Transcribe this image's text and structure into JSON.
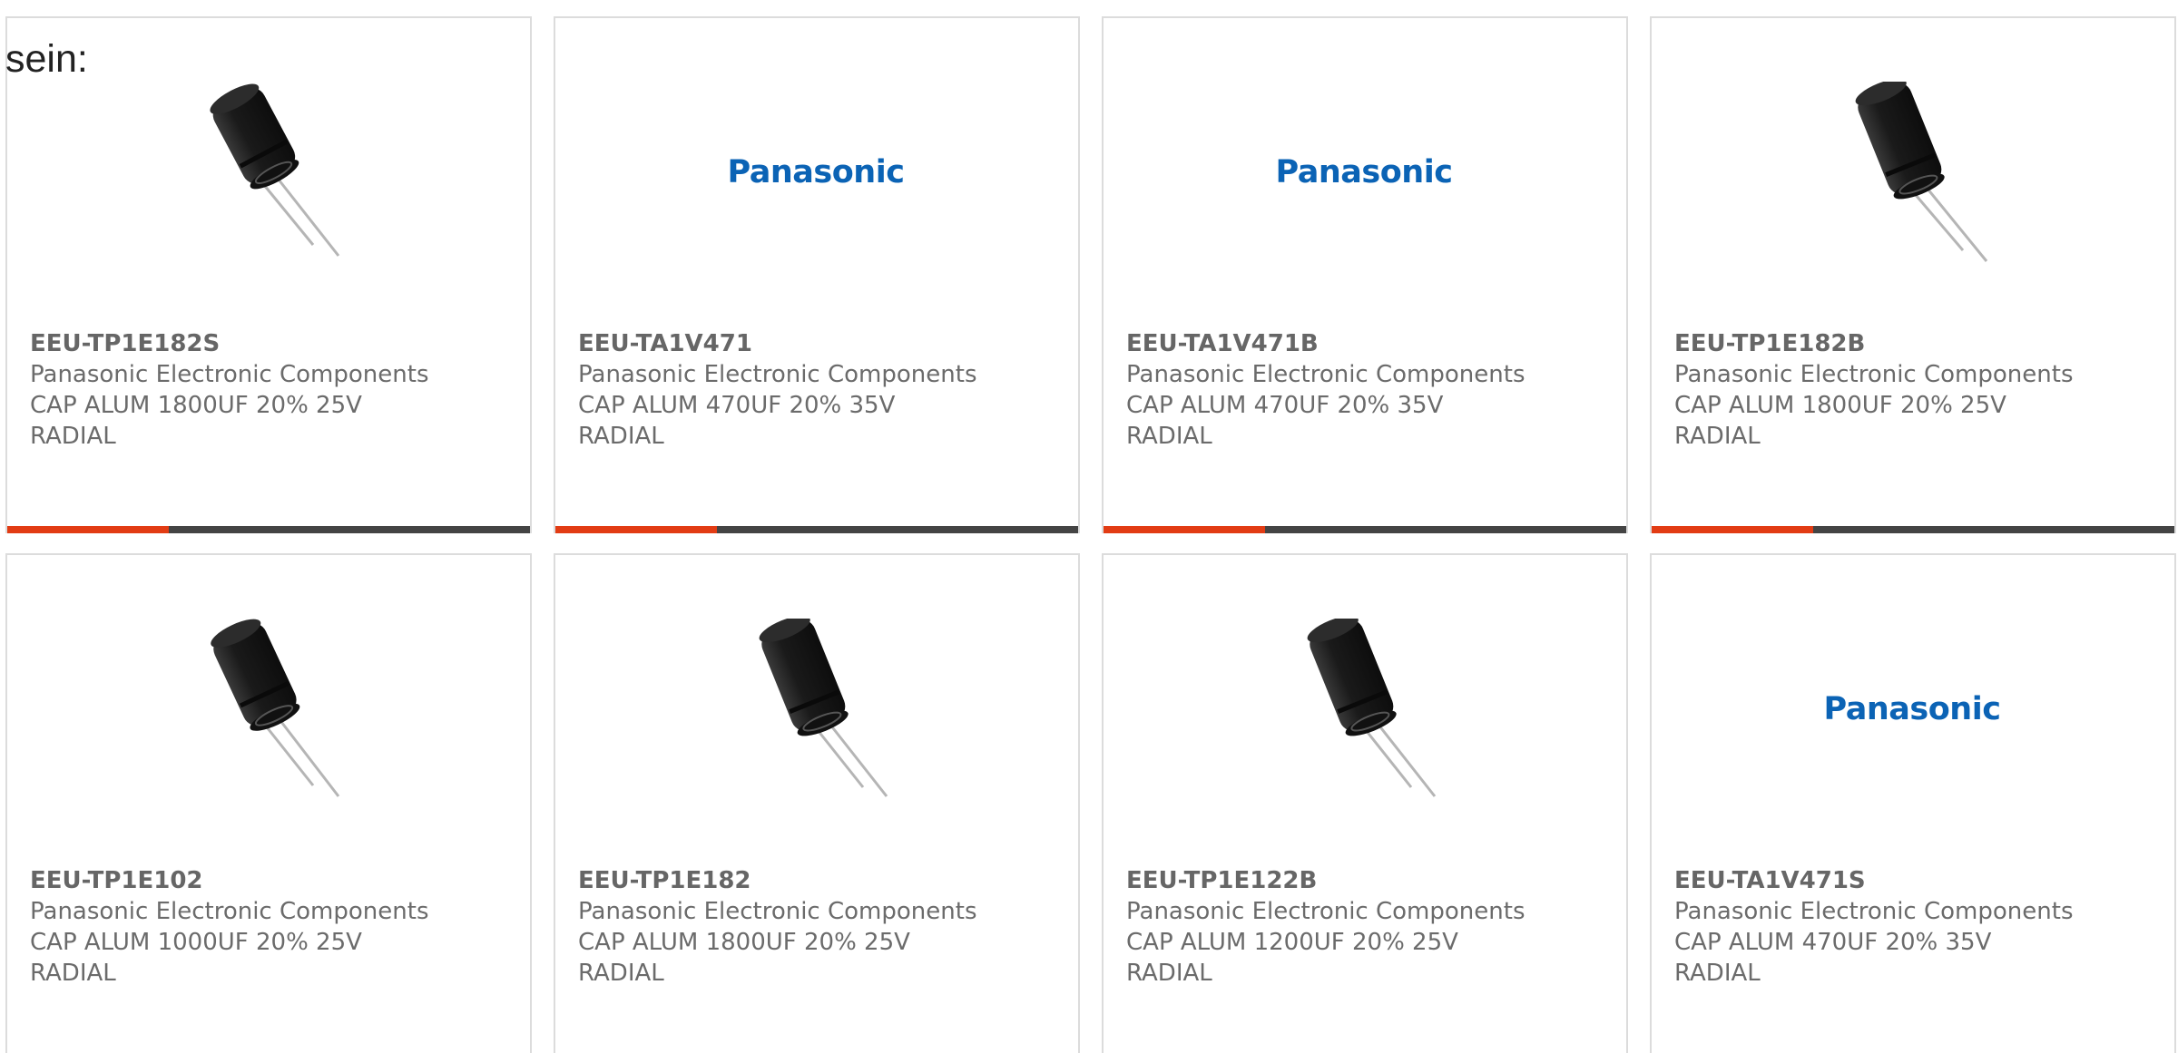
{
  "intro_text": "sein:",
  "colors": {
    "accent_bar": "#e23c14",
    "base_bar": "#444444",
    "card_border": "#dcdcdc",
    "brand_logo": "#0b63b5"
  },
  "products": [
    {
      "part": "EEU-TP1E182S",
      "maker": "Panasonic Electronic Components",
      "desc": "CAP ALUM 1800UF 20% 25V RADIAL",
      "image": "capacitor-image"
    },
    {
      "part": "EEU-TA1V471",
      "maker": "Panasonic Electronic Components",
      "desc": "CAP ALUM 470UF 20% 35V RADIAL",
      "image": "panasonic-logo",
      "logo_text": "Panasonic"
    },
    {
      "part": "EEU-TA1V471B",
      "maker": "Panasonic Electronic Components",
      "desc": "CAP ALUM 470UF 20% 35V RADIAL",
      "image": "panasonic-logo",
      "logo_text": "Panasonic"
    },
    {
      "part": "EEU-TP1E182B",
      "maker": "Panasonic Electronic Components",
      "desc": "CAP ALUM 1800UF 20% 25V RADIAL",
      "image": "capacitor-image"
    },
    {
      "part": "EEU-TP1E102",
      "maker": "Panasonic Electronic Components",
      "desc": "CAP ALUM 1000UF 20% 25V RADIAL",
      "image": "capacitor-image"
    },
    {
      "part": "EEU-TP1E182",
      "maker": "Panasonic Electronic Components",
      "desc": "CAP ALUM 1800UF 20% 25V RADIAL",
      "image": "capacitor-image"
    },
    {
      "part": "EEU-TP1E122B",
      "maker": "Panasonic Electronic Components",
      "desc": "CAP ALUM 1200UF 20% 25V RADIAL",
      "image": "capacitor-image"
    },
    {
      "part": "EEU-TA1V471S",
      "maker": "Panasonic Electronic Components",
      "desc": "CAP ALUM 470UF 20% 35V RADIAL",
      "image": "panasonic-logo",
      "logo_text": "Panasonic"
    }
  ],
  "card_progress_fraction": 0.31
}
